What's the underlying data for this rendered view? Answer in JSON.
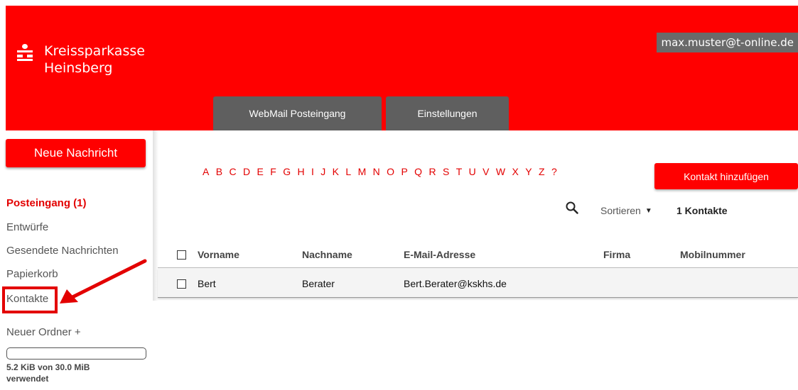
{
  "brand": {
    "line1": "Kreissparkasse",
    "line2": "Heinsberg"
  },
  "account": {
    "email": "max.muster@t-online.de"
  },
  "tabs": [
    {
      "label": "WebMail Posteingang"
    },
    {
      "label": "Einstellungen"
    }
  ],
  "sidebar": {
    "new_message": "Neue Nachricht",
    "items": [
      {
        "label": "Posteingang (1)"
      },
      {
        "label": "Entwürfe"
      },
      {
        "label": "Gesendete Nachrichten"
      },
      {
        "label": "Papierkorb"
      },
      {
        "label": "Kontakte"
      }
    ],
    "new_folder": "Neuer Ordner +",
    "quota_fraction": 0.0,
    "quota_text": "5.2 KiB von 30.0 MiB verwendet"
  },
  "contacts": {
    "alphabet": [
      "A",
      "B",
      "C",
      "D",
      "E",
      "F",
      "G",
      "H",
      "I",
      "J",
      "K",
      "L",
      "M",
      "N",
      "O",
      "P",
      "Q",
      "R",
      "S",
      "T",
      "U",
      "V",
      "W",
      "X",
      "Y",
      "Z",
      "?"
    ],
    "add_button": "Kontakt hinzufügen",
    "sort_label": "Sortieren",
    "count_label": "1 Kontakte",
    "columns": {
      "first": "Vorname",
      "last": "Nachname",
      "email": "E-Mail-Adresse",
      "company": "Firma",
      "mobile": "Mobilnummer"
    },
    "rows": [
      {
        "first": "Bert",
        "last": "Berater",
        "email": "Bert.Berater@kskhs.de",
        "company": "",
        "mobile": ""
      }
    ]
  },
  "colors": {
    "brand_red": "#ff0000",
    "tab_grey": "#5f5f5f",
    "annotation_red": "#e30000"
  },
  "icons": {
    "search": "search-icon",
    "sort_caret": "caret-down-icon",
    "annotation": "arrow-icon"
  }
}
